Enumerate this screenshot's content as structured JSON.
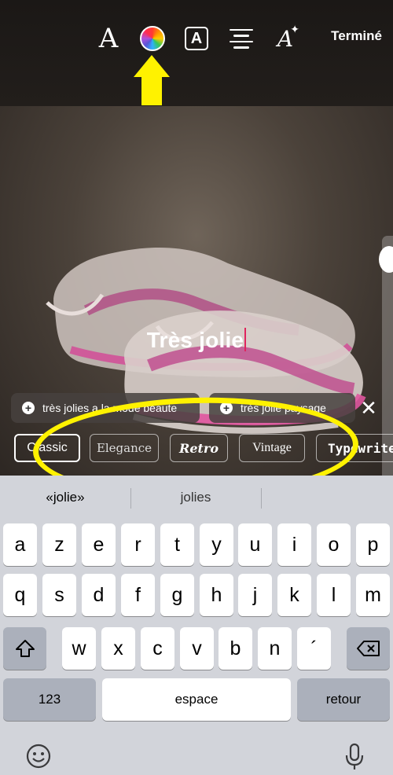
{
  "toolbar": {
    "font_icon": "font-icon",
    "font_glyph": "A",
    "color_icon": "color-wheel-icon",
    "background_icon": "text-background-icon",
    "background_glyph": "A",
    "align_icon": "align-center-icon",
    "effects_icon": "text-effects-icon",
    "effects_glyph": "A",
    "effects_sparkle": "✦",
    "done_label": "Terminé"
  },
  "canvas": {
    "caption_text": "Très jolie"
  },
  "suggestions": {
    "items": [
      {
        "label": "très jolies a la mode beaute",
        "icon": "add-icon",
        "plus": "+"
      },
      {
        "label": "très jolie paysage",
        "icon": "add-icon",
        "plus": "+"
      }
    ],
    "close_glyph": "✕"
  },
  "text_styles": [
    {
      "label": "Classic",
      "selected": true
    },
    {
      "label": "Elegance"
    },
    {
      "label": "Retro"
    },
    {
      "label": "Vintage"
    },
    {
      "label": "Typewriter"
    }
  ],
  "keyboard": {
    "predictions": [
      "«jolie»",
      "jolies",
      ""
    ],
    "row1": [
      "a",
      "z",
      "e",
      "r",
      "t",
      "y",
      "u",
      "i",
      "o",
      "p"
    ],
    "row2": [
      "q",
      "s",
      "d",
      "f",
      "g",
      "h",
      "j",
      "k",
      "l",
      "m"
    ],
    "row3": [
      "w",
      "x",
      "c",
      "v",
      "b",
      "n",
      "´"
    ],
    "shift_icon": "shift-icon",
    "delete_icon": "delete-icon",
    "numbers_label": "123",
    "space_label": "espace",
    "return_label": "retour",
    "emoji_icon": "emoji-icon",
    "mic_icon": "microphone-icon"
  },
  "annotations": {
    "color": "#fff200",
    "arrow_target": "color-wheel-icon"
  }
}
